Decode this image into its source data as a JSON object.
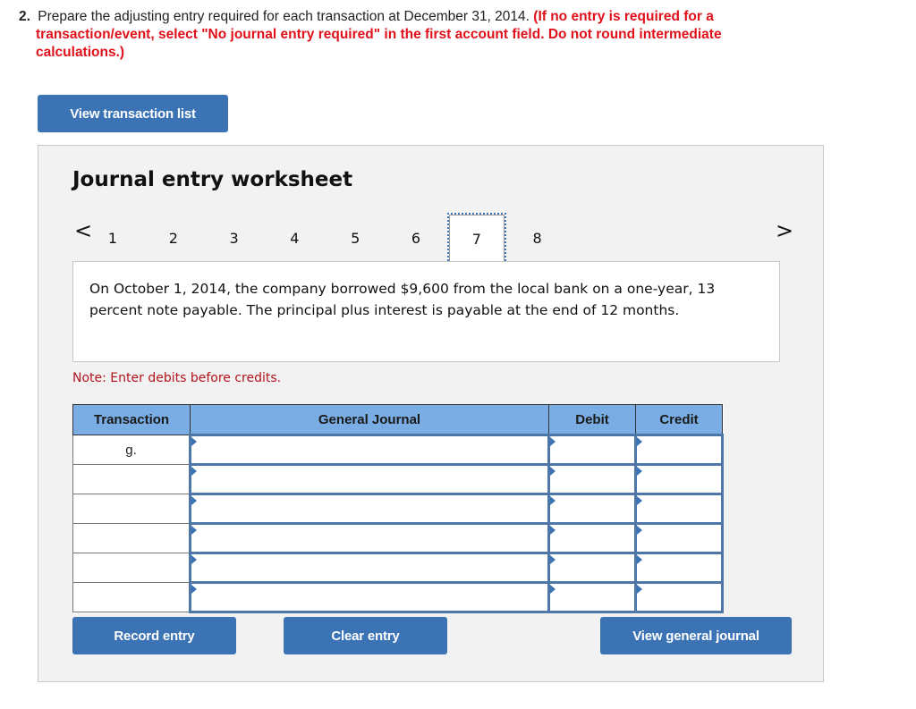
{
  "question": {
    "number": "2.",
    "text": "Prepare the adjusting entry required for each transaction at December 31, 2014.",
    "instruction": "(If no entry is required for a transaction/event, select \"No journal entry required\" in the first account field. Do not round intermediate calculations.)"
  },
  "buttons": {
    "view_transaction_list": "View transaction list",
    "record_entry": "Record entry",
    "clear_entry": "Clear entry",
    "view_general_journal": "View general journal"
  },
  "worksheet": {
    "title": "Journal entry worksheet",
    "nav": {
      "prev_icon": "chevron-left-icon",
      "next_icon": "chevron-right-icon",
      "prev_glyph": "<",
      "next_glyph": ">",
      "pages": [
        "1",
        "2",
        "3",
        "4",
        "5",
        "6",
        "7",
        "8"
      ],
      "active_page": "7"
    },
    "description": "On October 1, 2014, the company borrowed $9,600 from the local bank on a one-year, 13 percent note payable. The principal plus interest is payable at the end of 12 months.",
    "note": "Note: Enter debits before credits.",
    "table": {
      "headers": [
        "Transaction",
        "General Journal",
        "Debit",
        "Credit"
      ],
      "rows": [
        {
          "transaction": "g.",
          "account": "",
          "debit": "",
          "credit": ""
        },
        {
          "transaction": "",
          "account": "",
          "debit": "",
          "credit": ""
        },
        {
          "transaction": "",
          "account": "",
          "debit": "",
          "credit": ""
        },
        {
          "transaction": "",
          "account": "",
          "debit": "",
          "credit": ""
        },
        {
          "transaction": "",
          "account": "",
          "debit": "",
          "credit": ""
        },
        {
          "transaction": "",
          "account": "",
          "debit": "",
          "credit": ""
        }
      ]
    }
  },
  "colors": {
    "button_blue": "#3b73b5",
    "header_blue": "#7aade3",
    "instruction_red": "#e0101a",
    "note_red": "#b3121c",
    "panel_gray": "#f2f2f2"
  }
}
